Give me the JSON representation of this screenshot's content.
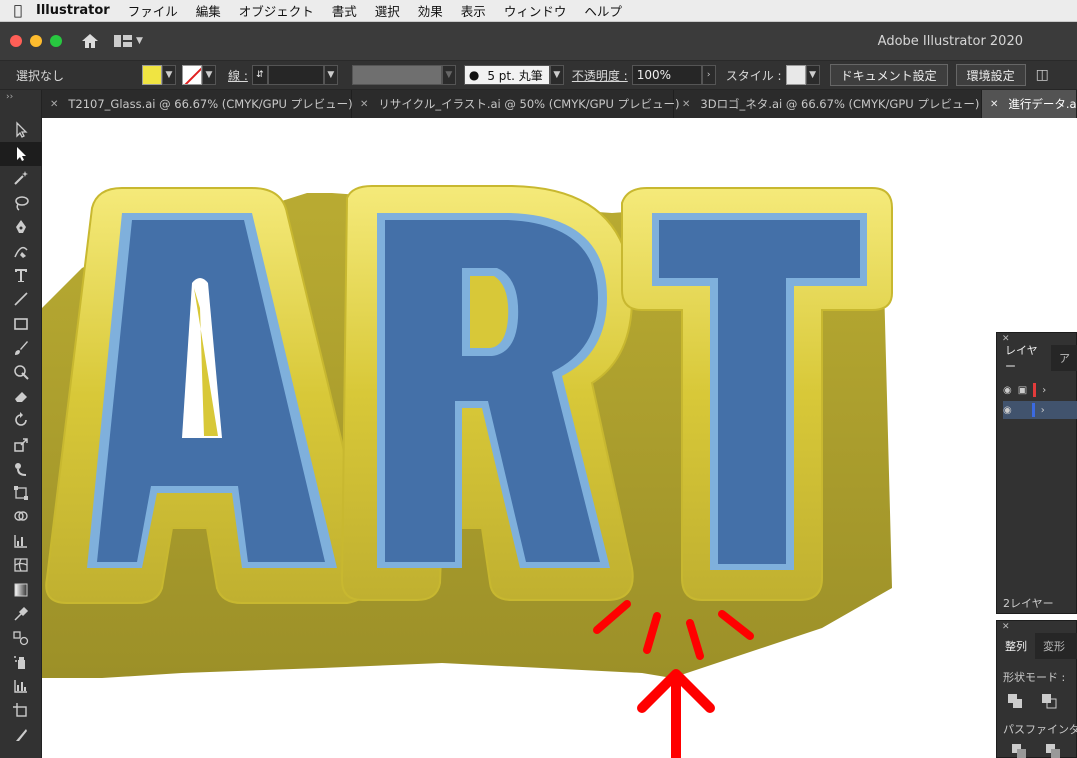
{
  "menubar": {
    "app": "Illustrator",
    "items": [
      "ファイル",
      "編集",
      "オブジェクト",
      "書式",
      "選択",
      "効果",
      "表示",
      "ウィンドウ",
      "ヘルプ"
    ]
  },
  "titlebar": {
    "title": "Adobe Illustrator 2020"
  },
  "control": {
    "selection": "選択なし",
    "stroke_label": "線 :",
    "brush": "5 pt. 丸筆",
    "opacity_label": "不透明度 :",
    "opacity_value": "100%",
    "style_label": "スタイル :",
    "doc_settings": "ドキュメント設定",
    "preferences": "環境設定",
    "fill_color": "#f0e442",
    "stroke_color": "#e02020"
  },
  "tabs": [
    {
      "label": "T2107_Glass.ai @ 66.67% (CMYK/GPU プレビュー)"
    },
    {
      "label": "リサイクル_イラスト.ai @ 50% (CMYK/GPU プレビュー)"
    },
    {
      "label": "3Dロゴ_ネタ.ai @ 66.67% (CMYK/GPU プレビュー)"
    },
    {
      "label": "進行データ.ai"
    }
  ],
  "canvas": {
    "artwork_text": "ART",
    "colors": {
      "blue": "#4470a8",
      "blue_light": "#7fb0dc",
      "yellow": "#d8c838",
      "yellow_dark": "#a69a2c",
      "annotation": "#ff0000"
    }
  },
  "layers_panel": {
    "tabs": [
      "レイヤー",
      "ア"
    ],
    "count": "2レイヤー",
    "layers": [
      {
        "color": "#e23b3b"
      },
      {
        "color": "#3b6ae2"
      }
    ]
  },
  "align_panel": {
    "tabs": [
      "整列",
      "変形"
    ],
    "shape_modes": "形状モード :",
    "pathfinder": "パスファインダ"
  }
}
